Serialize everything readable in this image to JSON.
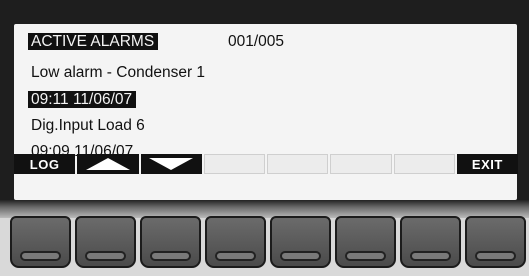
{
  "display": {
    "title": "ACTIVE ALARMS",
    "counter": "001/005",
    "alarms": [
      {
        "message": "Low alarm - Condenser 1",
        "timestamp": "09:11 11/06/07",
        "selected": true
      },
      {
        "message": "Dig.Input Load 6",
        "timestamp": "09:09 11/06/07",
        "selected": false
      }
    ]
  },
  "softkeys": {
    "log_label": "LOG",
    "up_icon": "triangle-up-icon",
    "down_icon": "triangle-down-icon",
    "exit_label": "EXIT"
  },
  "colors": {
    "lcd_background": "#f4f4f4",
    "lcd_ink": "#111111",
    "bezel": "#1e1e1e",
    "key": "#5a5a5a"
  }
}
